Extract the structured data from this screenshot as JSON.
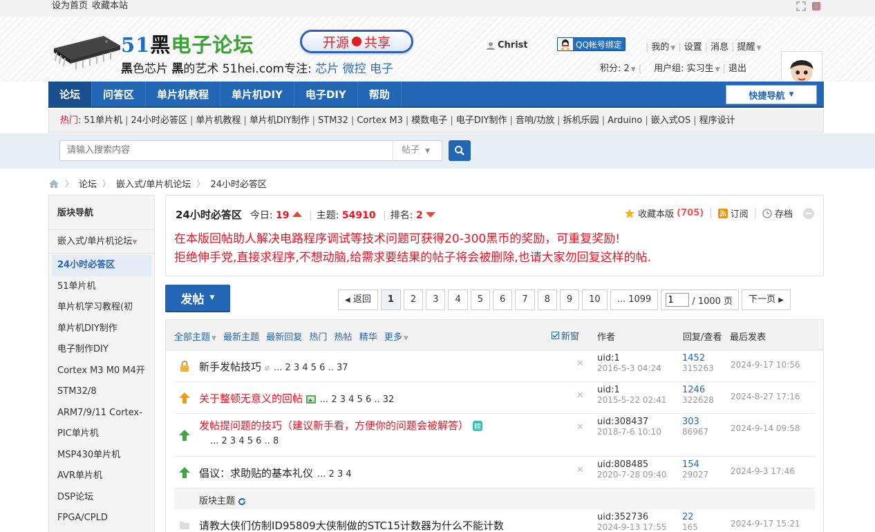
{
  "topbar": {
    "set_home": "设为首页",
    "bookmark": "收藏本站"
  },
  "header": {
    "logo_part1": "51",
    "logo_part2": "黑",
    "logo_part3": "电子论坛",
    "slogan_b1": "黑",
    "slogan_t1": "色芯片 ",
    "slogan_b2": "黑",
    "slogan_t2": "的艺术 51hei.com专注: ",
    "slogan_blue": "芯片 微控 电子",
    "share_left": "开源",
    "share_right": "共享",
    "username": "Christ",
    "qq_bind": "QQ帐号绑定",
    "menu_my": "我的",
    "menu_settings": "设置",
    "menu_messages": "消息",
    "menu_remind": "提醒",
    "points": "积分: 2",
    "user_group": "用户组: 实习生",
    "logout": "退出"
  },
  "nav": {
    "items": [
      "论坛",
      "问答区",
      "单片机教程",
      "单片机DIY",
      "电子DIY",
      "帮助"
    ],
    "quick_nav": "快捷导航"
  },
  "hotbar": {
    "label": "热门:",
    "items": [
      "51单片机",
      "24小时必答区",
      "单片机教程",
      "单片机DIY制作",
      "STM32",
      "Cortex M3",
      "模数电子",
      "电子DIY制作",
      "音响/功放",
      "拆机乐园",
      "Arduino",
      "嵌入式OS",
      "程序设计"
    ]
  },
  "search": {
    "placeholder": "请输入搜索内容",
    "type": "帖子"
  },
  "breadcrumb": [
    "论坛",
    "嵌入式/单片机论坛",
    "24小时必答区"
  ],
  "sidebar": {
    "title": "版块导航",
    "group": "嵌入式/单片机论坛",
    "items": [
      "24小时必答区",
      "51单片机",
      "单片机学习教程(初",
      "单片机DIY制作",
      "电子制作DIY",
      "Cortex M3 M0 M4开",
      "STM32/8",
      "ARM7/9/11 Cortex-",
      "PIC单片机",
      "MSP430单片机",
      "AVR单片机",
      "DSP论坛",
      "FPGA/CPLD"
    ]
  },
  "forum": {
    "name": "24小时必答区",
    "today_label": "今日:",
    "today": "19",
    "topics_label": "主题:",
    "topics": "54910",
    "rank_label": "排名:",
    "rank": "2",
    "favorite": "收藏本版",
    "favorite_count": "(705)",
    "subscribe": "订阅",
    "archive": "存档",
    "notice1": "在本版回帖助人解决电路程序调试等技术问题可获得20-300黑币的奖励，可重复奖励!",
    "notice2": "拒绝伸手党,直接求程序,不想动脑,给需求要结果的帖子将会被删除,也请大家勿回复这样的帖."
  },
  "post_button": "发帖",
  "pager": {
    "back": "返回",
    "pages": [
      "1",
      "2",
      "3",
      "4",
      "5",
      "6",
      "7",
      "8",
      "9",
      "10"
    ],
    "last": "... 1099",
    "input_value": "1",
    "total": "/ 1000 页",
    "next": "下一页"
  },
  "thread_header": {
    "all": "全部主题",
    "latest": "最新主题",
    "latest_reply": "最新回复",
    "hot": "热门",
    "hot_post": "热帖",
    "digest": "精华",
    "more": "更多",
    "new_window": "新窗",
    "author": "作者",
    "reply_view": "回复/查看",
    "last_post": "最后发表"
  },
  "threads": [
    {
      "title": "新手发帖技巧",
      "pages": "... 2 3 4 5 6 .. 37",
      "author": "uid:1",
      "date": "2016-5-3 04:24",
      "replies": "1452",
      "views": "315263",
      "last": "2024-9-17 10:56"
    },
    {
      "title": "关于整顿无意义的回帖",
      "pages": "... 2 3 4 5 6 .. 32",
      "author": "uid:1",
      "date": "2015-5-22 02:41",
      "replies": "1246",
      "views": "322628",
      "last": "2024-8-27 17:16"
    },
    {
      "title": "发帖提问题的技巧（建议新手看，方便你的问题会被解答）",
      "badge": "精",
      "pages": "... 2 3 4 5 6 .. 8",
      "author": "uid:308437",
      "date": "2018-7-6 10:10",
      "replies": "303",
      "views": "86967",
      "last": "2024-9-14 09:58"
    },
    {
      "title": "倡议：求助贴的基本礼仪",
      "pages": "... 2 3 4",
      "author": "uid:808485",
      "date": "2020-7-28 09:40",
      "replies": "154",
      "views": "29027",
      "last": "2024-9-3 17:46"
    }
  ],
  "section_label": "版块主题",
  "normal_thread": {
    "title": "请教大侠们仿制ID95809大侠制做的STC15计数器为什么不能计数",
    "author": "uid:352736",
    "date": "2024-9-13 17:55",
    "replies": "22",
    "views": "165",
    "last": "2024-9-17 15:21"
  },
  "colors": {
    "nav_blue": "#2266b5",
    "hot_red": "#ee1122",
    "logo_green": "#3aa133"
  }
}
